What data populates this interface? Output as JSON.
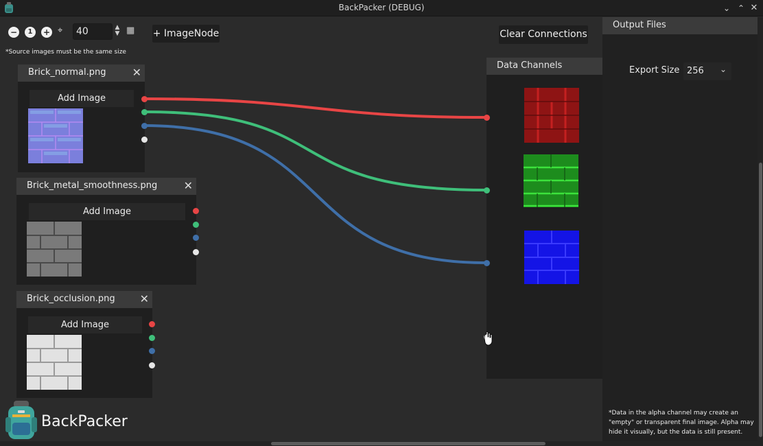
{
  "window": {
    "title": "BackPacker (DEBUG)"
  },
  "toolbar": {
    "zoom_value": "40",
    "add_node_label": "+ ImageNode",
    "clear_connections_label": "Clear Connections",
    "source_note": "*Source images must be the same size"
  },
  "nodes": [
    {
      "title": "Brick_normal.png",
      "add_image_label": "Add Image"
    },
    {
      "title": "Brick_metal_smoothness.png",
      "add_image_label": "Add Image"
    },
    {
      "title": "Brick_occlusion.png",
      "add_image_label": "Add Image"
    }
  ],
  "data_channels": {
    "title": "Data Channels"
  },
  "output": {
    "title": "Output Files",
    "export_size_label": "Export Size",
    "export_size_value": "256",
    "alpha_note": "*Data in the alpha channel may create an \"empty\" or transparent final image. Alpha may hide it visually, but the data is still present."
  },
  "branding": {
    "name": "BackPacker"
  },
  "colors": {
    "red": "#e84545",
    "green": "#3fbf7a",
    "blue": "#3f6fa8",
    "white": "#e6e6e6",
    "panel": "#1f1f1f",
    "header": "#3b3b3b"
  }
}
